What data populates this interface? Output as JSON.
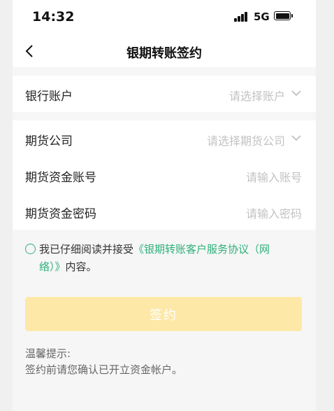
{
  "status_bar": {
    "time": "14:32",
    "network": "5G"
  },
  "nav": {
    "title": "银期转账签约"
  },
  "bank_section": {
    "bank_account": {
      "label": "银行账户",
      "placeholder": "请选择账户"
    }
  },
  "futures_section": {
    "company": {
      "label": "期货公司",
      "placeholder": "请选择期货公司"
    },
    "account": {
      "label": "期货资金账号",
      "placeholder": "请输入账号"
    },
    "password": {
      "label": "期货资金密码",
      "placeholder": "请输入密码"
    }
  },
  "agreement": {
    "prefix": "我已仔细阅读并接受",
    "link": "《银期转账客户服务协议（网络）》",
    "suffix": "内容。"
  },
  "submit": {
    "label": "签约"
  },
  "tips": {
    "title": "温馨提示:",
    "text": "签约前请您确认已开立资金帐户。"
  },
  "colors": {
    "accent": "#2db07b",
    "button_disabled": "#fde8a8"
  },
  "icons": [
    "back-arrow-icon",
    "chevron-down-icon",
    "signal-icon",
    "battery-icon",
    "radio-unchecked-icon"
  ]
}
